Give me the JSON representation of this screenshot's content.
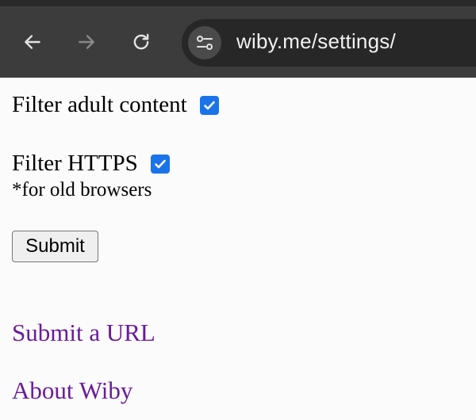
{
  "browser": {
    "url": "wiby.me/settings/"
  },
  "settings": {
    "filter_adult": {
      "label": "Filter adult content",
      "checked": true
    },
    "filter_https": {
      "label": "Filter HTTPS",
      "checked": true,
      "note": "*for old browsers"
    },
    "submit_label": "Submit"
  },
  "links": {
    "submit_url": "Submit a URL",
    "about": "About Wiby"
  },
  "colors": {
    "toolbar": "#3c3c3c",
    "omnibox": "#272727",
    "checkbox_accent": "#1a73e8",
    "visited_link": "#6a1b9a",
    "page_background": "#fbfbfb"
  }
}
